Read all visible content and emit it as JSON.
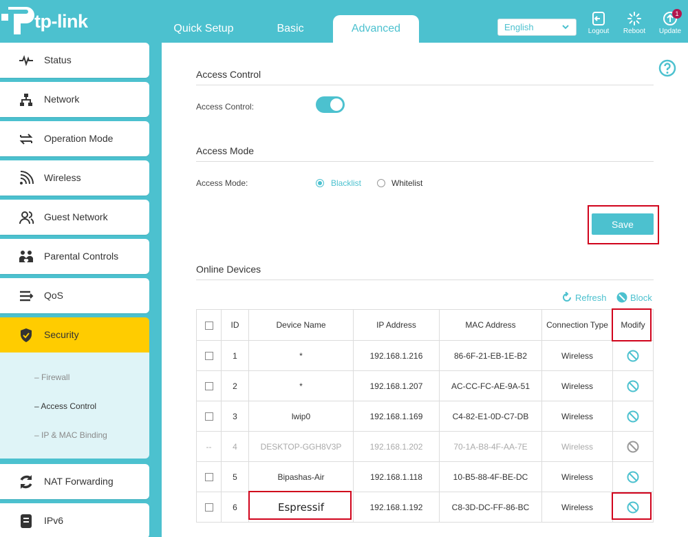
{
  "header": {
    "brand": "tp-link",
    "tabs": [
      {
        "label": "Quick Setup"
      },
      {
        "label": "Basic"
      },
      {
        "label": "Advanced",
        "active": true
      }
    ],
    "language": "English",
    "buttons": [
      {
        "label": "Logout",
        "icon": "logout-icon"
      },
      {
        "label": "Reboot",
        "icon": "reboot-icon"
      },
      {
        "label": "Update",
        "icon": "update-icon",
        "badge": "1"
      }
    ]
  },
  "sidebar": {
    "items": [
      {
        "label": "Status",
        "icon": "pulse-icon"
      },
      {
        "label": "Network",
        "icon": "network-icon"
      },
      {
        "label": "Operation Mode",
        "icon": "operation-mode-icon"
      },
      {
        "label": "Wireless",
        "icon": "wireless-icon"
      },
      {
        "label": "Guest Network",
        "icon": "guest-network-icon"
      },
      {
        "label": "Parental Controls",
        "icon": "parental-controls-icon"
      },
      {
        "label": "QoS",
        "icon": "qos-icon"
      },
      {
        "label": "Security",
        "icon": "shield-icon",
        "active": true
      },
      {
        "label": "NAT Forwarding",
        "icon": "nat-forwarding-icon"
      },
      {
        "label": "IPv6",
        "icon": "ipv6-icon"
      }
    ],
    "submenu": [
      {
        "label": "Firewall"
      },
      {
        "label": "Access Control",
        "selected": true
      },
      {
        "label": "IP & MAC Binding"
      }
    ]
  },
  "access_control": {
    "section_title": "Access Control",
    "label": "Access Control:",
    "enabled": true
  },
  "access_mode": {
    "section_title": "Access Mode",
    "label": "Access Mode:",
    "options": [
      "Blacklist",
      "Whitelist"
    ],
    "selected": "Blacklist"
  },
  "save_label": "Save",
  "online_devices": {
    "section_title": "Online Devices",
    "refresh_label": "Refresh",
    "block_label": "Block",
    "columns": [
      "ID",
      "Device Name",
      "IP Address",
      "MAC Address",
      "Connection Type",
      "Modify"
    ],
    "rows": [
      {
        "id": "1",
        "name": "*",
        "ip": "192.168.1.216",
        "mac": "86-6F-21-EB-1E-B2",
        "type": "Wireless",
        "disabled": false
      },
      {
        "id": "2",
        "name": "*",
        "ip": "192.168.1.207",
        "mac": "AC-CC-FC-AE-9A-51",
        "type": "Wireless",
        "disabled": false
      },
      {
        "id": "3",
        "name": "lwip0",
        "ip": "192.168.1.169",
        "mac": "C4-82-E1-0D-C7-DB",
        "type": "Wireless",
        "disabled": false
      },
      {
        "id": "4",
        "name": "DESKTOP-GGH8V3P",
        "ip": "192.168.1.202",
        "mac": "70-1A-B8-4F-AA-7E",
        "type": "Wireless",
        "disabled": true,
        "checkbox_text": "--"
      },
      {
        "id": "5",
        "name": "Bipashas-Air",
        "ip": "192.168.1.118",
        "mac": "10-B5-88-4F-BE-DC",
        "type": "Wireless",
        "disabled": false
      },
      {
        "id": "6",
        "name": "Espressif",
        "ip": "192.168.1.192",
        "mac": "C8-3D-DC-FF-86-BC",
        "type": "Wireless",
        "disabled": false
      }
    ]
  },
  "colors": {
    "accent": "#4cc1cf",
    "active_nav": "#ffcc00",
    "highlight_box": "#d0021b",
    "badge": "#b2174e"
  }
}
